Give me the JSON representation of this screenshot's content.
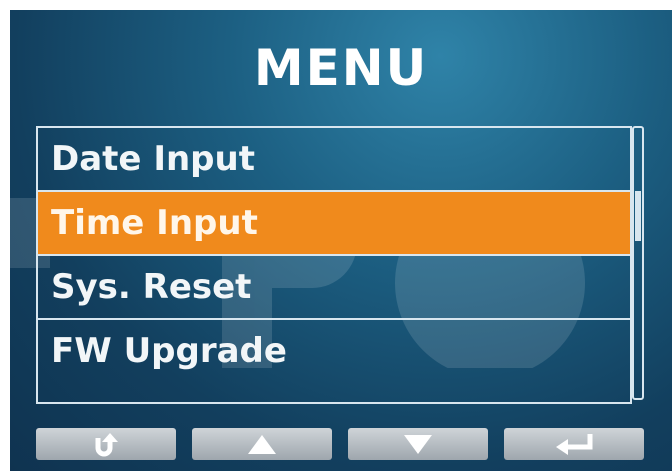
{
  "title": "MENU",
  "menu": {
    "items": [
      {
        "label": "Date Input",
        "selected": false
      },
      {
        "label": "Time Input",
        "selected": true
      },
      {
        "label": "Sys. Reset",
        "selected": false
      },
      {
        "label": "FW Upgrade",
        "selected": false
      }
    ]
  },
  "scrollbar": {
    "position_fraction": 0.25
  },
  "colors": {
    "selected_row": "#f08a1c",
    "background": "#1c5f82",
    "button": "#b7bec4"
  },
  "buttons": [
    {
      "icon": "return-icon"
    },
    {
      "icon": "up-arrow-icon"
    },
    {
      "icon": "down-arrow-icon"
    },
    {
      "icon": "enter-icon"
    }
  ]
}
